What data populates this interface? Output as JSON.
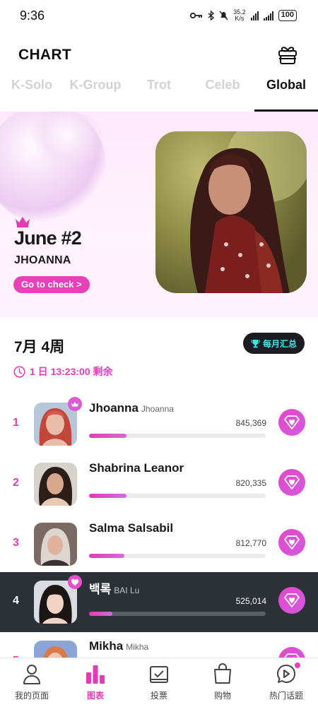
{
  "status_bar": {
    "time": "9:36",
    "net_speed_value": "35.2",
    "net_speed_unit": "K/s",
    "battery": "100"
  },
  "header": {
    "title": "CHART"
  },
  "tabs": [
    {
      "label": "K-Solo",
      "active": false
    },
    {
      "label": "K-Group",
      "active": false
    },
    {
      "label": "Trot",
      "active": false
    },
    {
      "label": "Celeb",
      "active": false
    },
    {
      "label": "Global",
      "active": true
    }
  ],
  "banner": {
    "rank": "June #2",
    "artist": "JHOANNA",
    "check_label": "Go to check >"
  },
  "week": {
    "title": "7月 4周",
    "monthly_label": "每月汇总",
    "countdown": "1 日 13:23:00 剩余"
  },
  "ranking": [
    {
      "rank": "1",
      "name": "Jhoanna",
      "subname": "Jhoanna",
      "score": "845,369",
      "progress": 0.21,
      "badge": "crown-icon"
    },
    {
      "rank": "2",
      "name": "Shabrina Leanor",
      "subname": "",
      "score": "820,335",
      "progress": 0.21
    },
    {
      "rank": "3",
      "name": "Salma Salsabil",
      "subname": "",
      "score": "812,770",
      "progress": 0.2
    },
    {
      "rank": "4",
      "name": "백록",
      "subname": "BAI Lu",
      "score": "525,014",
      "progress": 0.13,
      "badge": "heart-icon"
    },
    {
      "rank": "5",
      "name": "Mikha",
      "subname": "Mikha",
      "score": "",
      "progress": 0.1
    }
  ],
  "bottom_nav": [
    {
      "label": "我的页面",
      "icon": "person-icon"
    },
    {
      "label": "图表",
      "icon": "chart-icon",
      "active": true
    },
    {
      "label": "投票",
      "icon": "vote-box-icon"
    },
    {
      "label": "购物",
      "icon": "shopping-bag-icon"
    },
    {
      "label": "热门话题",
      "icon": "topic-bubble-icon"
    }
  ],
  "colors": {
    "accent": "#e33bb4",
    "highlight_row": "#2c3037",
    "monthly_text": "#3ee6ea"
  }
}
